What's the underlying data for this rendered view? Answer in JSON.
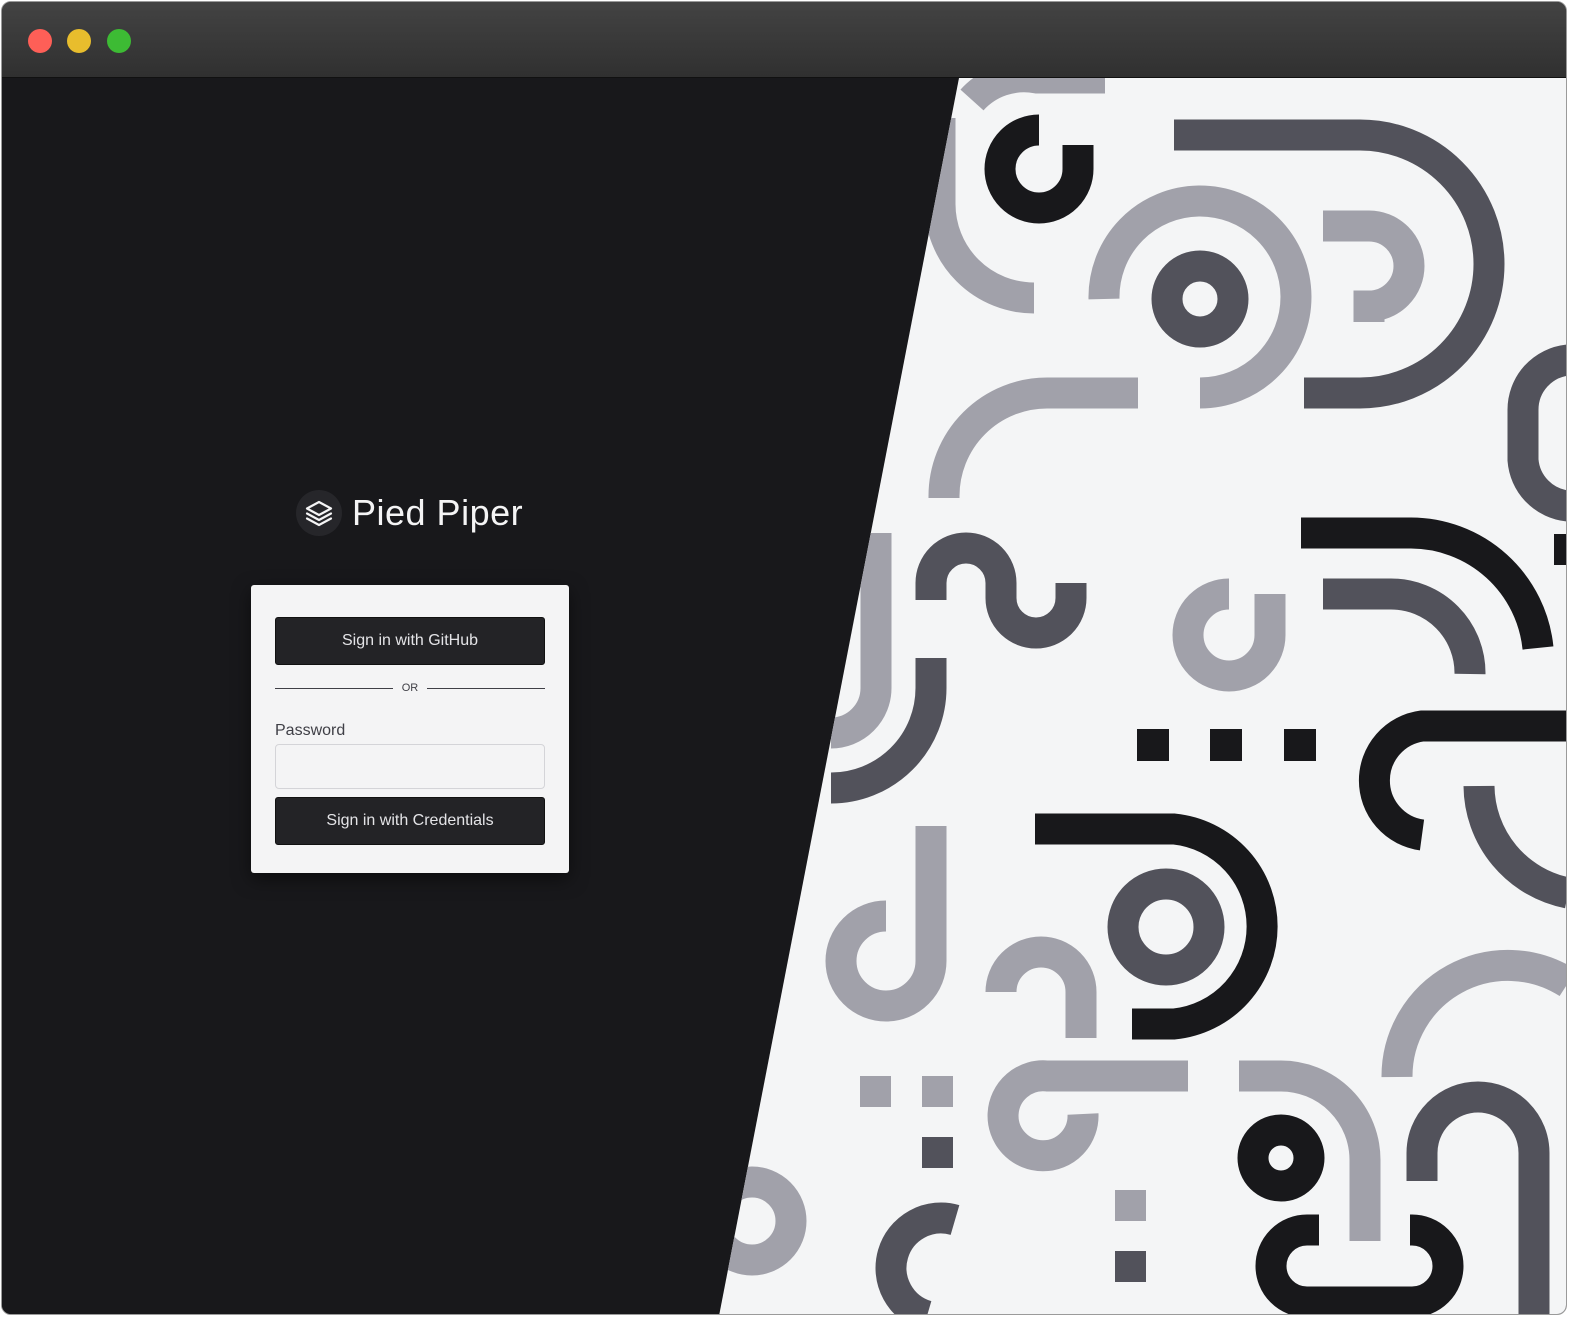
{
  "window": {
    "controls": [
      "close",
      "minimize",
      "zoom"
    ]
  },
  "brand": {
    "name": "Pied Piper",
    "logo_icon": "stacked-layers-icon"
  },
  "login": {
    "github_button_label": "Sign in with GitHub",
    "divider_text": "OR",
    "password_label": "Password",
    "password_value": "",
    "credentials_button_label": "Sign in with Credentials"
  },
  "colors": {
    "dark_panel": "#18181b",
    "light_panel": "#f4f5f6",
    "shape_black": "#18181b",
    "shape_dark_gray": "#52525b",
    "shape_light_gray": "#a1a1aa",
    "card_background": "#f4f4f5",
    "button_background": "#232326"
  }
}
